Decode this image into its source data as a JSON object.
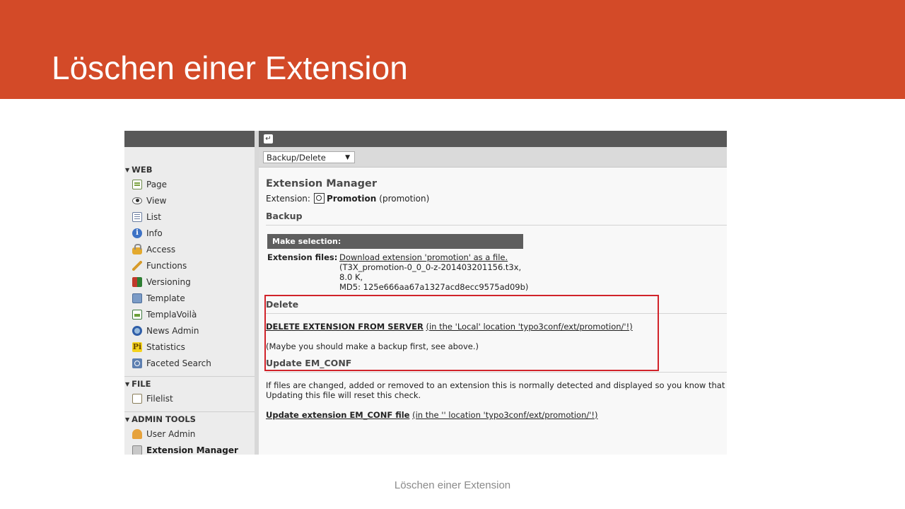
{
  "slide": {
    "title": "Löschen einer Extension",
    "footer": "Löschen einer Extension",
    "accent_color": "#d34a28",
    "highlight_color": "#d1232a"
  },
  "sidebar": {
    "groups": [
      {
        "title": "WEB",
        "items": [
          {
            "label": "Page",
            "icon": "page-icon"
          },
          {
            "label": "View",
            "icon": "view-eye-icon"
          },
          {
            "label": "List",
            "icon": "list-icon"
          },
          {
            "label": "Info",
            "icon": "info-icon"
          },
          {
            "label": "Access",
            "icon": "lock-icon"
          },
          {
            "label": "Functions",
            "icon": "wand-icon"
          },
          {
            "label": "Versioning",
            "icon": "versioning-icon"
          },
          {
            "label": "Template",
            "icon": "template-icon"
          },
          {
            "label": "TemplaVoilà",
            "icon": "templavoila-icon"
          },
          {
            "label": "News Admin",
            "icon": "news-globe-icon"
          },
          {
            "label": "Statistics",
            "icon": "pi-statistics-icon"
          },
          {
            "label": "Faceted Search",
            "icon": "search-icon"
          }
        ]
      },
      {
        "title": "FILE",
        "items": [
          {
            "label": "Filelist",
            "icon": "filelist-icon"
          }
        ]
      },
      {
        "title": "ADMIN TOOLS",
        "items": [
          {
            "label": "User Admin",
            "icon": "user-icon"
          },
          {
            "label": "Extension Manager",
            "icon": "extension-icon",
            "active": true
          }
        ]
      }
    ]
  },
  "toolbar": {
    "back_icon": "return-arrow-icon",
    "back_glyph": "↵",
    "menu_select": "Backup/Delete"
  },
  "content": {
    "heading": "Extension Manager",
    "extension_label": "Extension:",
    "extension_name": "Promotion",
    "extension_key": "(promotion)",
    "backup": {
      "title": "Backup",
      "table_header": "Make selection:",
      "row_label": "Extension files:",
      "download_link": "Download extension 'promotion' as a file.",
      "file_name": "(T3X_promotion-0_0_0-z-201403201156.t3x,",
      "file_size": "8.0 K,",
      "md5": "MD5: 125e666aa67a1327acd8ecc9575ad09b)"
    },
    "delete": {
      "title": "Delete",
      "link": "DELETE EXTENSION FROM SERVER",
      "link_detail": "(in the 'Local' location 'typo3conf/ext/promotion/'!)",
      "hint": "(Maybe you should make a backup first, see above.)"
    },
    "update": {
      "title": "Update EM_CONF",
      "text_line1": "If files are changed, added or removed to an extension this is normally detected and displayed so you know that t",
      "text_line2": "Updating this file will reset this check.",
      "link": "Update extension EM_CONF file",
      "link_detail": "(in the '' location 'typo3conf/ext/promotion/'!)"
    }
  }
}
